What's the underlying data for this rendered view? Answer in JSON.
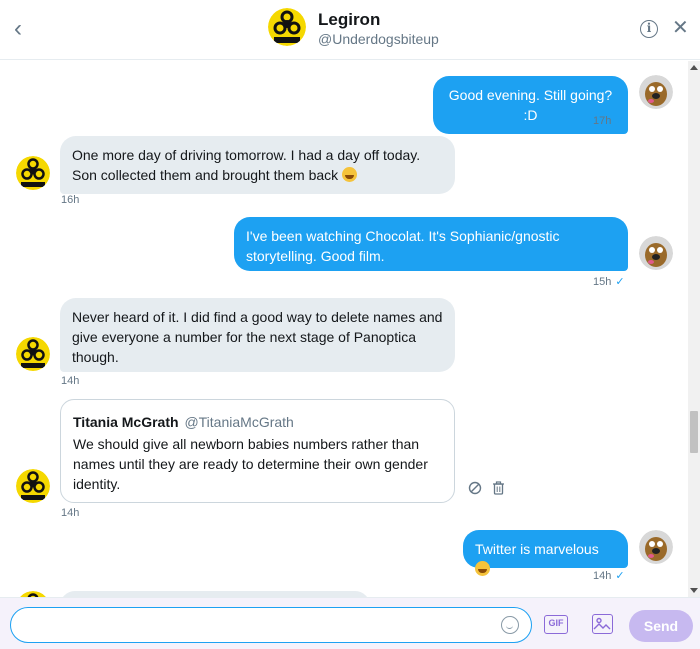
{
  "header": {
    "name": "Legiron",
    "handle": "@Underdogsbiteup",
    "info_symbol": "i",
    "close_symbol": "✕",
    "back_symbol": "‹"
  },
  "colors": {
    "accent": "#1da1f2",
    "received_bubble": "#e6ecf0",
    "send_button": "#c7b9f0",
    "composer_icons": "#8b6ad8"
  },
  "messages": [
    {
      "from": "me",
      "text": "Good evening. Still going? :D",
      "time": "17h"
    },
    {
      "from": "them",
      "text_line1": "One more day of driving tomorrow. I had a day off today.",
      "text_line2": "Son collected them and brought them back",
      "emoji": "grinning-face",
      "time": "16h"
    },
    {
      "from": "me",
      "text_line1": "I've been watching Chocolat. It's Sophianic/gnostic",
      "text_line2": "storytelling. Good film.",
      "time": "15h"
    },
    {
      "from": "them",
      "text_line1": "Never heard of it. I did find a good way to delete names and",
      "text_line2": "give everyone a number for the next stage of Panoptica",
      "text_line3": "though.",
      "time": "14h"
    },
    {
      "from": "them",
      "shared_tweet": {
        "author": "Titania McGrath",
        "handle": "@TitaniaMcGrath",
        "line1": "We should give all newborn babies numbers rather than",
        "line2": "names until they are ready to determine their own gender",
        "line3": "identity."
      },
      "time": "14h"
    },
    {
      "from": "me",
      "text": "Twitter is marvelous",
      "emoji": "rolling-laughing-face",
      "time": "14h"
    }
  ],
  "composer": {
    "placeholder": "",
    "gif_label": "GIF",
    "send_label": "Send"
  },
  "icons": [
    "back-icon",
    "hazard-avatar-icon",
    "info-icon",
    "close-icon",
    "dog-avatar-icon",
    "read-check-icon",
    "report-icon",
    "delete-icon",
    "emoji-icon",
    "gif-icon",
    "media-icon"
  ]
}
